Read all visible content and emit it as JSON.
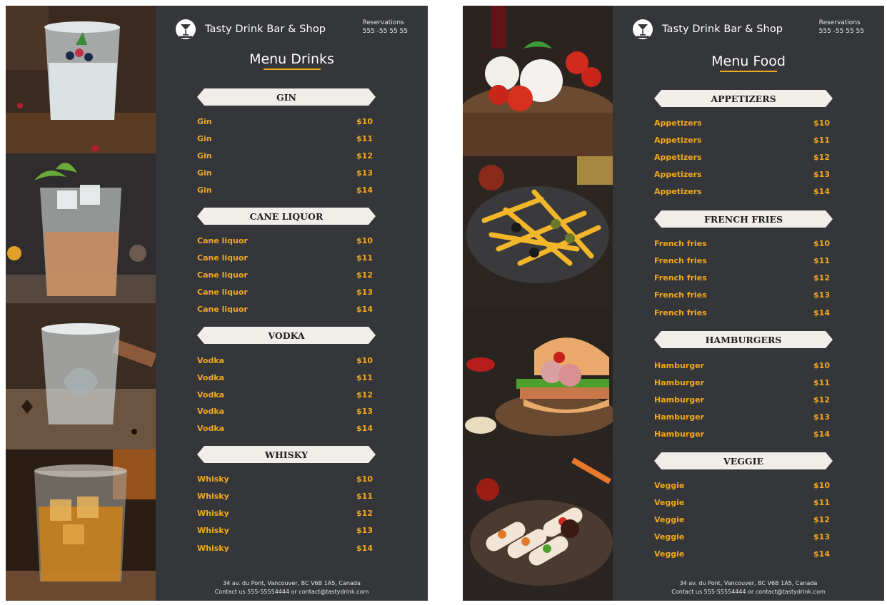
{
  "left_page": {
    "brand": {
      "name": "Tasty Drink Bar & Shop",
      "logo_icon": "martini-logo-icon"
    },
    "reservations": {
      "label": "Reservations",
      "phone": "555 -55 55 55"
    },
    "title": "Menu Drinks",
    "sections": [
      {
        "heading": "GIN",
        "items": [
          {
            "name": "Gin",
            "price": "$10"
          },
          {
            "name": "Gin",
            "price": "$11"
          },
          {
            "name": "Gin",
            "price": "$12"
          },
          {
            "name": "Gin",
            "price": "$13"
          },
          {
            "name": "Gin",
            "price": "$14"
          }
        ]
      },
      {
        "heading": "CANE LIQUOR",
        "items": [
          {
            "name": "Cane liquor",
            "price": "$10"
          },
          {
            "name": "Cane liquor",
            "price": "$11"
          },
          {
            "name": "Cane liquor",
            "price": "$12"
          },
          {
            "name": "Cane liquor",
            "price": "$13"
          },
          {
            "name": "Cane liquor",
            "price": "$14"
          }
        ]
      },
      {
        "heading": "VODKA",
        "items": [
          {
            "name": "Vodka",
            "price": "$10"
          },
          {
            "name": "Vodka",
            "price": "$11"
          },
          {
            "name": "Vodka",
            "price": "$12"
          },
          {
            "name": "Vodka",
            "price": "$13"
          },
          {
            "name": "Vodka",
            "price": "$14"
          }
        ]
      },
      {
        "heading": "WHISKY",
        "items": [
          {
            "name": "Whisky",
            "price": "$10"
          },
          {
            "name": "Whisky",
            "price": "$11"
          },
          {
            "name": "Whisky",
            "price": "$12"
          },
          {
            "name": "Whisky",
            "price": "$13"
          },
          {
            "name": "Whisky",
            "price": "$14"
          }
        ]
      }
    ],
    "footer": {
      "address": "34 av. du Pont, Vancouver, BC V6B 1A5, Canada",
      "contact": "Contact us  555-55554444 or  contact@tastydrink.com"
    }
  },
  "right_page": {
    "brand": {
      "name": "Tasty Drink Bar & Shop",
      "logo_icon": "martini-logo-icon"
    },
    "reservations": {
      "label": "Reservations",
      "phone": "555 -55 55 55"
    },
    "title": "Menu Food",
    "sections": [
      {
        "heading": "APPETIZERS",
        "items": [
          {
            "name": "Appetizers",
            "price": "$10"
          },
          {
            "name": "Appetizers",
            "price": "$11"
          },
          {
            "name": "Appetizers",
            "price": "$12"
          },
          {
            "name": "Appetizers",
            "price": "$13"
          },
          {
            "name": "Appetizers",
            "price": "$14"
          }
        ]
      },
      {
        "heading": "FRENCH FRIES",
        "items": [
          {
            "name": "French fries",
            "price": "$10"
          },
          {
            "name": "French fries",
            "price": "$11"
          },
          {
            "name": "French fries",
            "price": "$12"
          },
          {
            "name": "French fries",
            "price": "$13"
          },
          {
            "name": "French fries",
            "price": "$14"
          }
        ]
      },
      {
        "heading": "HAMBURGERS",
        "items": [
          {
            "name": "Hamburger",
            "price": "$10"
          },
          {
            "name": "Hamburger",
            "price": "$11"
          },
          {
            "name": "Hamburger",
            "price": "$12"
          },
          {
            "name": "Hamburger",
            "price": "$13"
          },
          {
            "name": "Hamburger",
            "price": "$14"
          }
        ]
      },
      {
        "heading": "VEGGIE",
        "items": [
          {
            "name": "Veggie",
            "price": "$10"
          },
          {
            "name": "Veggie",
            "price": "$11"
          },
          {
            "name": "Veggie",
            "price": "$12"
          },
          {
            "name": "Veggie",
            "price": "$13"
          },
          {
            "name": "Veggie",
            "price": "$14"
          }
        ]
      }
    ],
    "footer": {
      "address": "34 av. du Pont, Vancouver, BC V6B 1A5, Canada",
      "contact": "Contact us  555-55554444 or  contact@tastydrink.com"
    }
  },
  "colors": {
    "panel_background": "#34363a",
    "accent": "#f2a81f",
    "banner": "#f1eeea",
    "text": "#ffffff"
  },
  "photos": {
    "left": [
      "gin-glass-photo",
      "cane-liquor-glass-photo",
      "vodka-glass-photo",
      "whisky-glass-photo"
    ],
    "right": [
      "caprese-appetizer-photo",
      "french-fries-photo",
      "hamburger-photo",
      "veggie-rolls-photo"
    ]
  }
}
